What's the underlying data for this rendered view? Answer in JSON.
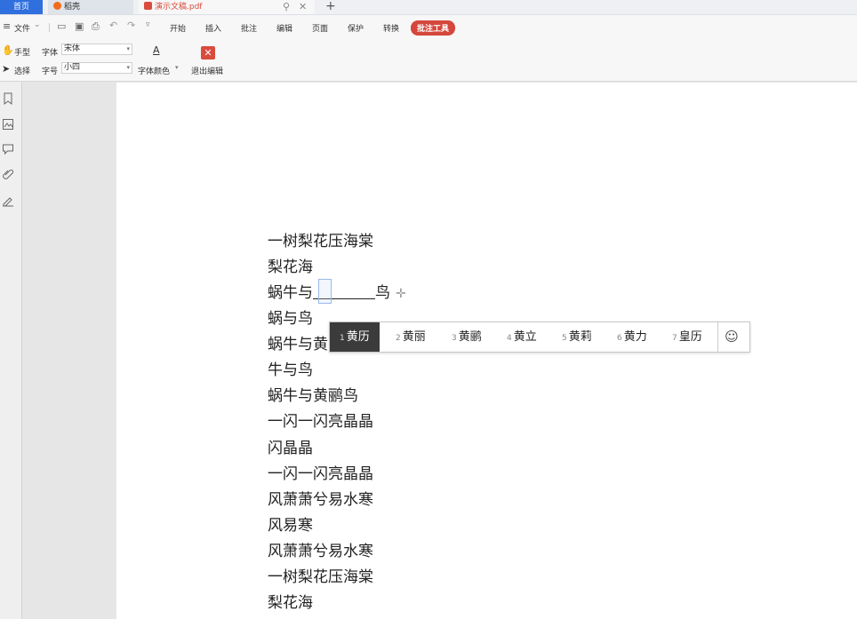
{
  "tabs": {
    "home": "首页",
    "daoke": "稻壳",
    "pdf": "演示文稿.pdf"
  },
  "menubar": {
    "file": "文件",
    "items": [
      "开始",
      "插入",
      "批注",
      "编辑",
      "页面",
      "保护",
      "转换"
    ],
    "active_tool": "批注工具"
  },
  "toolbar": {
    "hand": "手型",
    "select": "选择",
    "font_label": "字体",
    "font_value": "宋体",
    "size_label": "字号",
    "size_value": "小四",
    "font_color": "字体颜色",
    "exit_edit": "退出编辑"
  },
  "doc": {
    "lines": [
      "一树梨花压海棠",
      "梨花海",
      "蜗牛与",
      "蜗与鸟",
      "蜗牛与黄",
      "牛与鸟",
      "蜗牛与黄鹂鸟",
      "一闪一闪亮晶晶",
      "闪晶晶",
      "一闪一闪亮晶晶",
      "风萧萧兮易水寒",
      "风易寒",
      "风萧萧兮易水寒",
      "一树梨花压海棠",
      "梨花海"
    ],
    "line3_tail": "鸟"
  },
  "ime": {
    "candidates": [
      {
        "num": "1",
        "text": "黄历"
      },
      {
        "num": "2",
        "text": "黄丽"
      },
      {
        "num": "3",
        "text": "黄鹂"
      },
      {
        "num": "4",
        "text": "黄立"
      },
      {
        "num": "5",
        "text": "黄莉"
      },
      {
        "num": "6",
        "text": "黄力"
      },
      {
        "num": "7",
        "text": "皇历"
      }
    ],
    "emoji": "☺"
  },
  "colors": {
    "accent_blue": "#2f6fde",
    "accent_red": "#d5473b"
  }
}
